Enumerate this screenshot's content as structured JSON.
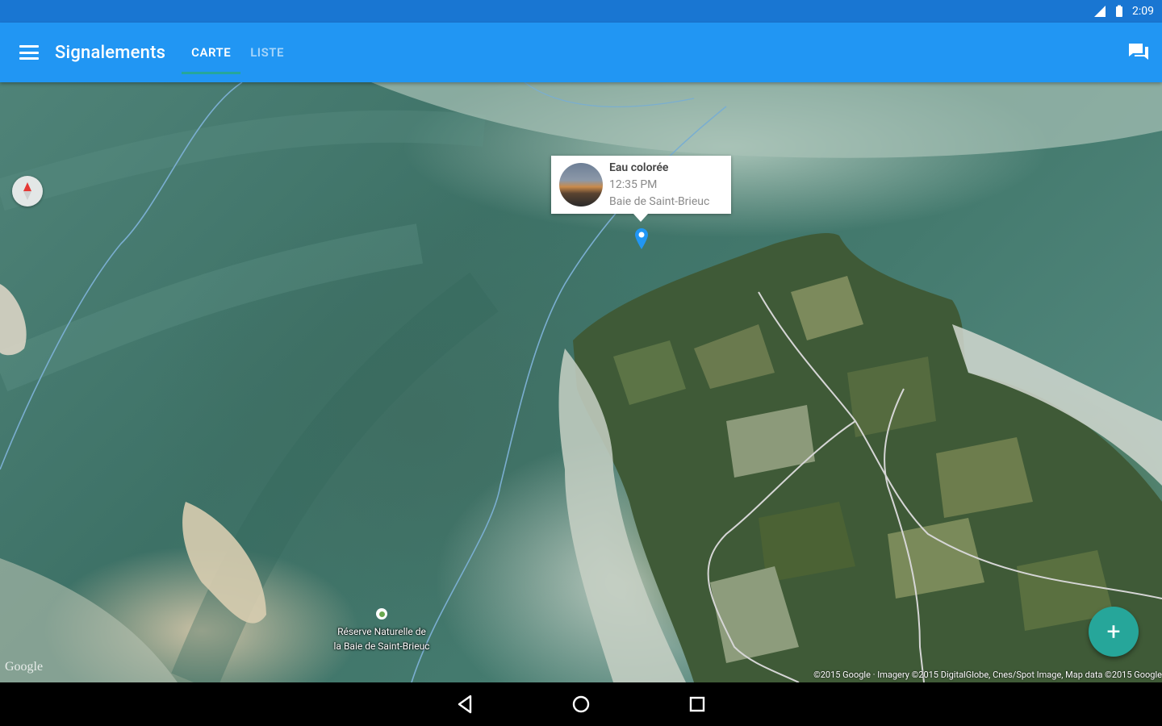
{
  "status_bar": {
    "time": "2:09",
    "icons": [
      "signal-icon",
      "battery-icon"
    ]
  },
  "app_bar": {
    "title": "Signalements",
    "menu_icon": "menu-icon",
    "chat_icon": "chat-icon",
    "tabs": [
      {
        "label": "CARTE",
        "active": true
      },
      {
        "label": "LISTE",
        "active": false
      }
    ],
    "colors": {
      "primary": "#2196f3",
      "status": "#1976d2",
      "accent": "#26a69a"
    }
  },
  "map": {
    "compass_icon": "compass-icon",
    "info_window": {
      "title": "Eau colorée",
      "time": "12:35 PM",
      "location": "Baie de Saint-Brieuc"
    },
    "marker_icon": "location-pin-icon",
    "poi": {
      "line1": "Réserve Naturelle de",
      "line2": "la Baie de Saint-Brieuc"
    },
    "logo": "Google",
    "attribution": "©2015 Google · Imagery ©2015 DigitalGlobe, Cnes/Spot Image, Map data ©2015 Google"
  },
  "fab": {
    "label": "+",
    "icon": "add-icon"
  },
  "nav_bar": {
    "icons": [
      "back-icon",
      "home-icon",
      "recents-icon"
    ]
  }
}
